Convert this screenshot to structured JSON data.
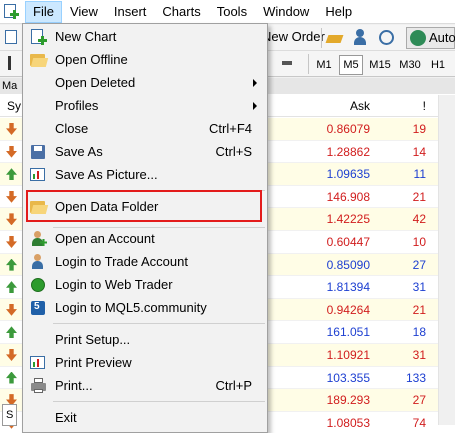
{
  "menubar": {
    "items": [
      "File",
      "View",
      "Insert",
      "Charts",
      "Tools",
      "Window",
      "Help"
    ],
    "active": "File"
  },
  "toolbar": {
    "new_order_label": "New Order",
    "auto_label": "Auto",
    "timeframes": [
      "M1",
      "M5",
      "M15",
      "M30",
      "H1"
    ],
    "active_timeframe": "M5"
  },
  "market_watch": {
    "title": "Ma",
    "symbol_header": "Sy",
    "ask_header": "Ask",
    "spread_header": "!",
    "bottom_tab": "S",
    "rows": [
      {
        "dir": "down",
        "ask": "0.86079",
        "spread": "19",
        "color": "red"
      },
      {
        "dir": "down",
        "ask": "1.28862",
        "spread": "14",
        "color": "red"
      },
      {
        "dir": "up",
        "ask": "1.09635",
        "spread": "11",
        "color": "blue"
      },
      {
        "dir": "down",
        "ask": "146.908",
        "spread": "21",
        "color": "red"
      },
      {
        "dir": "down",
        "ask": "1.42225",
        "spread": "42",
        "color": "red"
      },
      {
        "dir": "down",
        "ask": "0.60447",
        "spread": "10",
        "color": "red"
      },
      {
        "dir": "up",
        "ask": "0.85090",
        "spread": "27",
        "color": "blue"
      },
      {
        "dir": "up",
        "ask": "1.81394",
        "spread": "31",
        "color": "blue"
      },
      {
        "dir": "down",
        "ask": "0.94264",
        "spread": "21",
        "color": "red"
      },
      {
        "dir": "up",
        "ask": "161.051",
        "spread": "18",
        "color": "blue"
      },
      {
        "dir": "down",
        "ask": "1.10921",
        "spread": "31",
        "color": "red"
      },
      {
        "dir": "up",
        "ask": "103.355",
        "spread": "133",
        "color": "blue"
      },
      {
        "dir": "down",
        "ask": "189.293",
        "spread": "27",
        "color": "red"
      },
      {
        "dir": "down",
        "ask": "1.08053",
        "spread": "74",
        "color": "red"
      }
    ]
  },
  "file_menu": {
    "new_chart": "New Chart",
    "open_offline": "Open Offline",
    "open_deleted": "Open Deleted",
    "profiles": "Profiles",
    "close": "Close",
    "close_shortcut": "Ctrl+F4",
    "save_as": "Save As",
    "save_as_shortcut": "Ctrl+S",
    "save_as_picture": "Save As Picture...",
    "open_data_folder": "Open Data Folder",
    "open_account": "Open an Account",
    "login_trade": "Login to Trade Account",
    "login_web": "Login to Web Trader",
    "login_mql5": "Login to MQL5.community",
    "print_setup": "Print Setup...",
    "print_preview": "Print Preview",
    "print": "Print...",
    "print_shortcut": "Ctrl+P",
    "exit": "Exit"
  },
  "colors": {
    "highlight_border": "#e31b1b",
    "ask_down": "#d11d1d",
    "ask_up": "#1d3fd1"
  }
}
